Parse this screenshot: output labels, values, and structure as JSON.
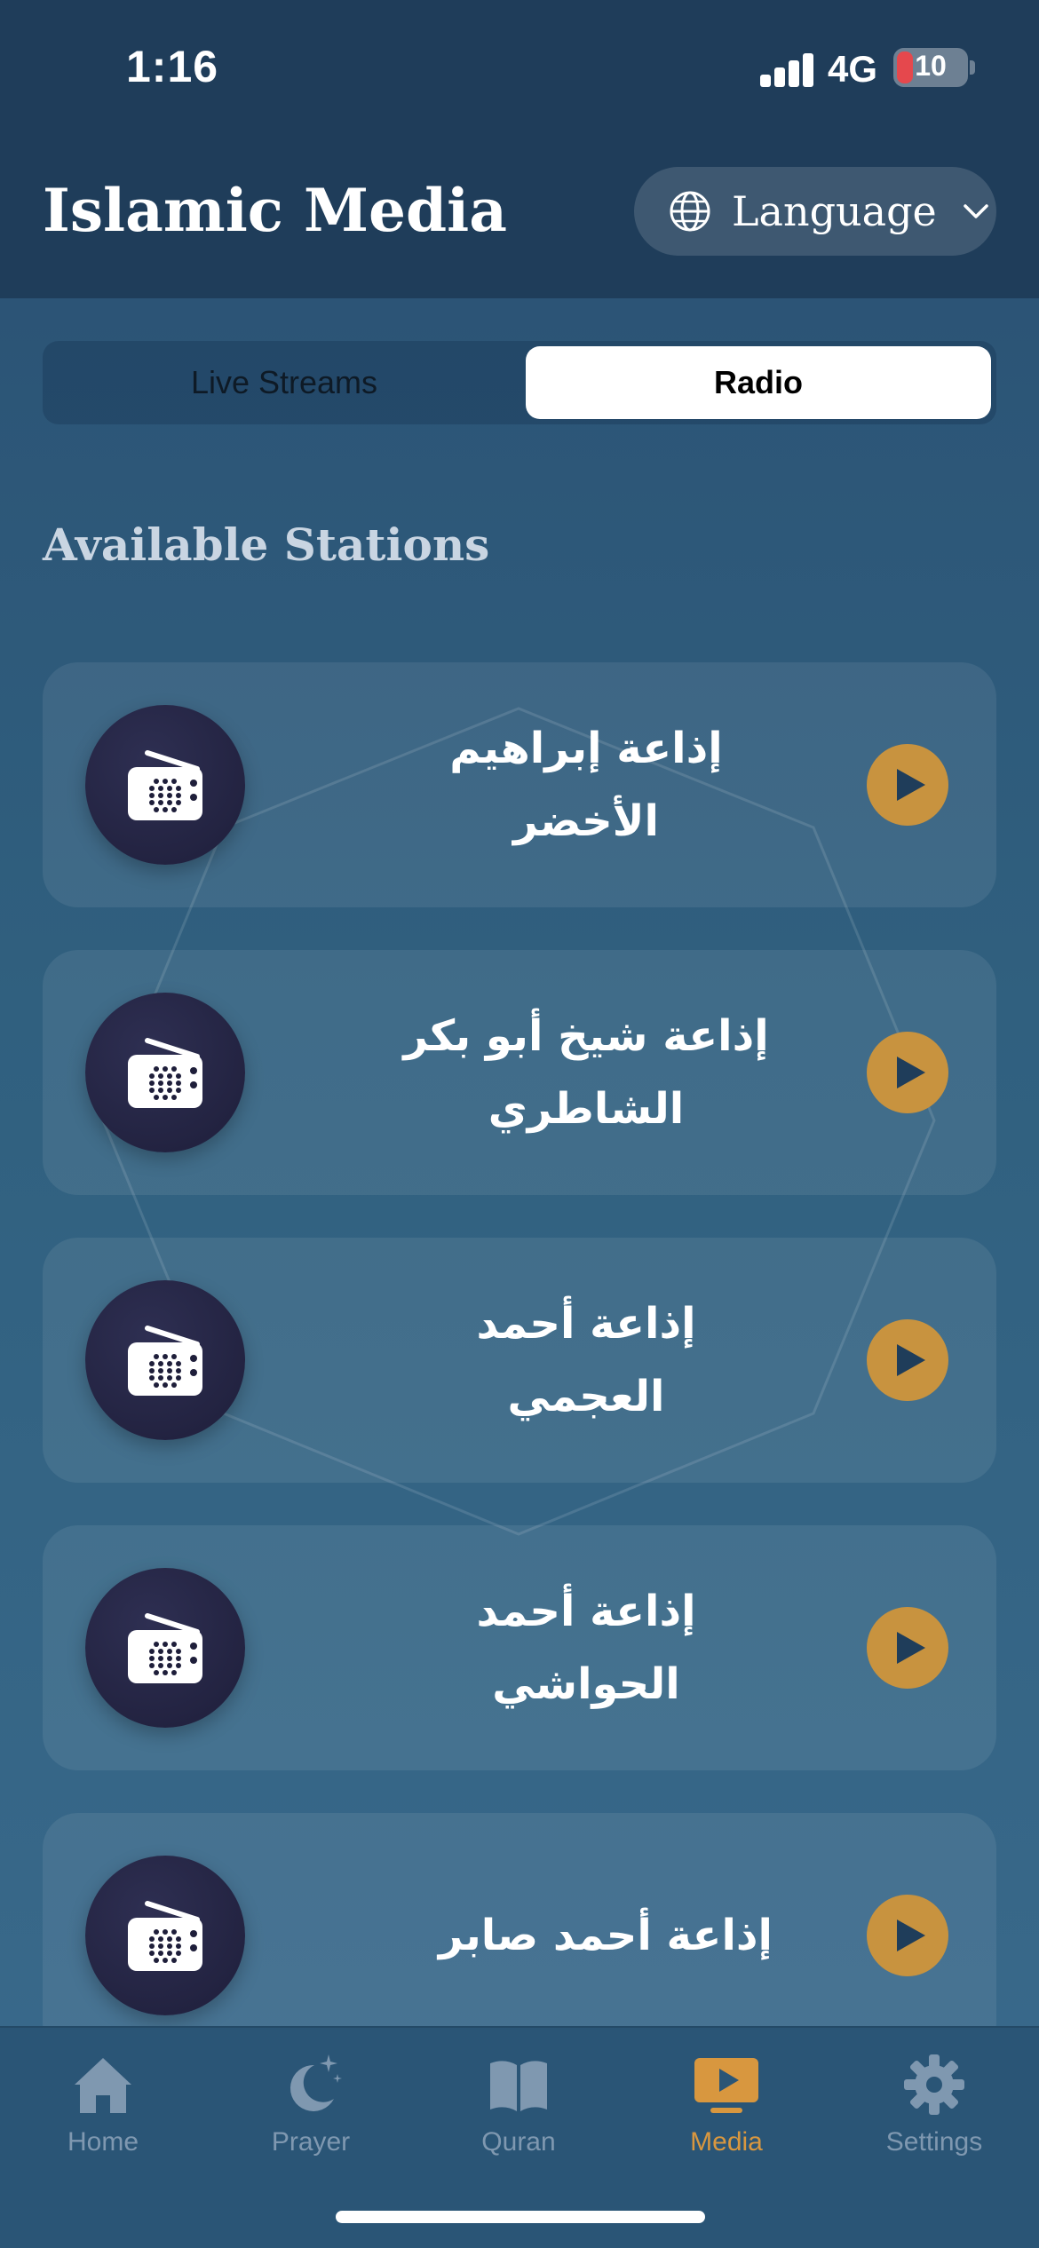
{
  "status_bar": {
    "time": "1:16",
    "network": "4G",
    "battery": "10"
  },
  "header": {
    "title": "Islamic Media",
    "language_label": "Language"
  },
  "segments": {
    "live": "Live Streams",
    "radio": "Radio",
    "selected": "Radio"
  },
  "section_title": "Available Stations",
  "stations": [
    {
      "name": "إذاعة إبراهيم الأخضر"
    },
    {
      "name": "إذاعة شيخ أبو بكر الشاطري"
    },
    {
      "name": "إذاعة أحمد العجمي"
    },
    {
      "name": "إذاعة أحمد الحواشي"
    },
    {
      "name": "إذاعة أحمد صابر"
    }
  ],
  "tabs": [
    {
      "label": "Home",
      "icon": "home-icon"
    },
    {
      "label": "Prayer",
      "icon": "moon-stars-icon"
    },
    {
      "label": "Quran",
      "icon": "book-icon"
    },
    {
      "label": "Media",
      "icon": "tv-play-icon",
      "active": true
    },
    {
      "label": "Settings",
      "icon": "gear-icon"
    }
  ],
  "colors": {
    "accent": "#d8973f",
    "play": "#c8933f",
    "header": "#1f3d5a",
    "inactive_tab": "#7f98b0"
  }
}
